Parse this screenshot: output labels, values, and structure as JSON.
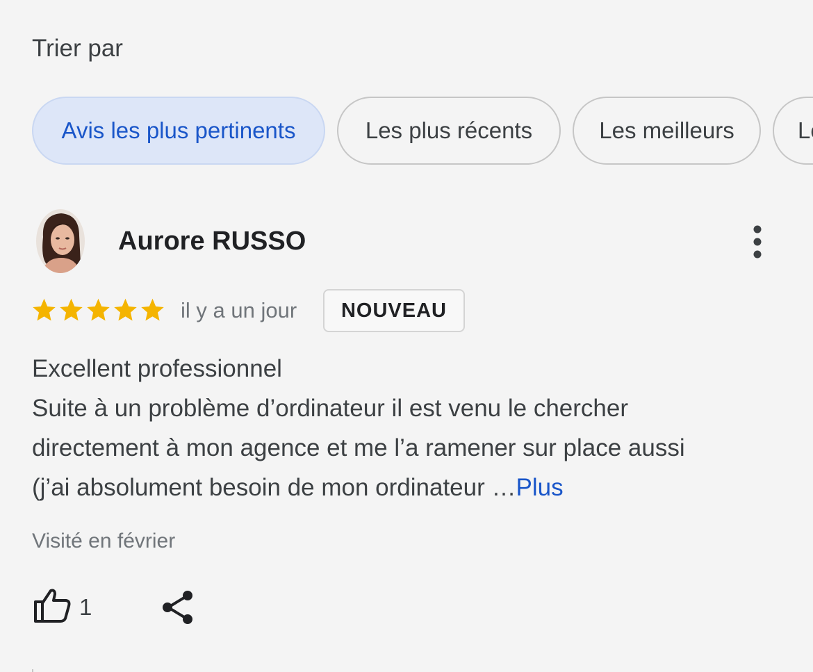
{
  "sort": {
    "label": "Trier par",
    "chips": [
      {
        "label": "Avis les plus pertinents",
        "active": true
      },
      {
        "label": "Les plus récents",
        "active": false
      },
      {
        "label": "Les meilleurs",
        "active": false
      },
      {
        "label": "Les",
        "active": false
      }
    ]
  },
  "review": {
    "author": "Aurore RUSSO",
    "rating": 5,
    "rating_max": 5,
    "time_ago": "il y a un jour",
    "badge": "NOUVEAU",
    "text_lines": [
      "Excellent professionnel",
      "Suite à un problème d’ordinateur il est venu le chercher",
      "directement à mon agence et me l’a ramener sur place aussi",
      "(j’ai absolument besoin de mon ordinateur …"
    ],
    "more_label": "Plus",
    "visited": "Visité en février",
    "likes": "1"
  },
  "icons": {
    "avatar": "avatar-photo",
    "menu": "more-vert-icon",
    "star": "star-icon",
    "like": "thumb-up-icon",
    "share": "share-icon"
  },
  "colors": {
    "star": "#f4b400",
    "accent": "#1a56c9",
    "active_chip_bg": "#dde6f8"
  }
}
